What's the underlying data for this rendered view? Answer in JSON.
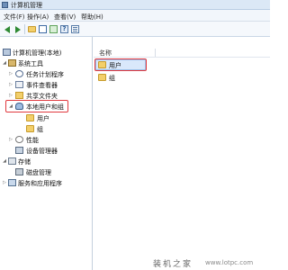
{
  "window": {
    "title": "计算机管理"
  },
  "menu": [
    "文件(F)",
    "操作(A)",
    "查看(V)",
    "帮助(H)"
  ],
  "toolbar": {
    "buttons": [
      "back-arrow-icon",
      "forward-arrow-icon",
      "up-folder-icon",
      "console-tree-icon",
      "refresh-icon",
      "help-icon",
      "properties-grid-icon"
    ]
  },
  "tree": {
    "root": "计算机管理(本地)",
    "system_tools": "系统工具",
    "task_scheduler": "任务计划程序",
    "event_viewer": "事件查看器",
    "shared_folders": "共享文件夹",
    "local_users_groups": "本地用户和组",
    "users": "用户",
    "groups": "组",
    "performance": "性能",
    "device_manager": "设备管理器",
    "storage": "存储",
    "disk_management": "磁盘管理",
    "services_apps": "服务和应用程序"
  },
  "list": {
    "column_name": "名称",
    "items": [
      "用户",
      "组"
    ]
  },
  "watermark": {
    "text": "装机之家",
    "url": "www.lotpc.com"
  },
  "colors": {
    "highlight": "#e0393e",
    "selection": "#d9e8fb"
  }
}
